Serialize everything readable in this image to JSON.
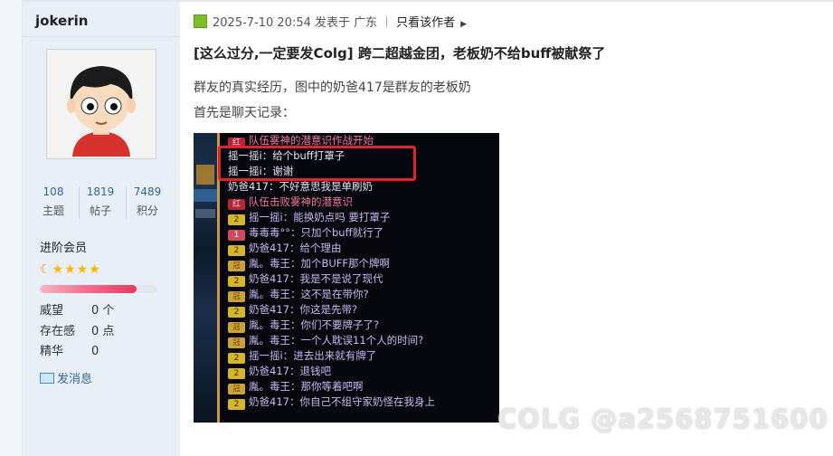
{
  "sidebar": {
    "username": "jokerin",
    "stats": [
      {
        "value": "108",
        "label": "主题"
      },
      {
        "value": "1819",
        "label": "帖子"
      },
      {
        "value": "7489",
        "label": "积分"
      }
    ],
    "rank": "进阶会员",
    "level_progress": 0.82,
    "info": [
      {
        "key": "威望",
        "value": "0 个"
      },
      {
        "key": "存在感",
        "value": "0 点"
      },
      {
        "key": "精华",
        "value": "0"
      }
    ],
    "message_label": "发消息"
  },
  "post": {
    "meta_time": "2025-7-10 20:54",
    "meta_location": "发表于 广东",
    "author_only": "只看该作者",
    "title": "[这么过分,一定要发Colg] 跨二超越金团，老板奶不给buff被献祭了",
    "para1": "群友的真实经历，图中的奶爸417是群友的老板奶",
    "para2": "首先是聊天记录："
  },
  "chat": [
    {
      "badge": "红",
      "badge_type": "red",
      "text": "队伍雾神的潜意识作战开始",
      "color": "pink"
    },
    {
      "badge": "",
      "badge_type": "",
      "text": "摇一摇i：给个buff打罩子",
      "color": "light"
    },
    {
      "badge": "",
      "badge_type": "",
      "text": "摇一摇i：谢谢",
      "color": "light"
    },
    {
      "badge": "",
      "badge_type": "",
      "text": "奶爸417：不好意思我是单刷奶",
      "color": "light"
    },
    {
      "badge": "红",
      "badge_type": "red",
      "text": "队伍击败雾神的潜意识",
      "color": "pink"
    },
    {
      "badge": "2",
      "badge_type": "two",
      "text": "摇一摇i：能换奶点吗 要打罩子",
      "color": "purp"
    },
    {
      "badge": "1",
      "badge_type": "one",
      "text": "毒毒毒°°：只加个buff就行了",
      "color": "purp"
    },
    {
      "badge": "2",
      "badge_type": "two",
      "text": "奶爸417：给个理由",
      "color": "purp"
    },
    {
      "badge": "冠",
      "badge_type": "crown",
      "text": "胤。毒王：加个BUFF那个牌啊",
      "color": "purp"
    },
    {
      "badge": "2",
      "badge_type": "two",
      "text": "奶爸417：我是不是说了现代",
      "color": "purp"
    },
    {
      "badge": "冠",
      "badge_type": "crown",
      "text": "胤。毒王：这不是在带你?",
      "color": "purp"
    },
    {
      "badge": "2",
      "badge_type": "two",
      "text": "奶爸417：你这是先带?",
      "color": "purp"
    },
    {
      "badge": "冠",
      "badge_type": "crown",
      "text": "胤。毒王：你们不要牌子了?",
      "color": "purp"
    },
    {
      "badge": "冠",
      "badge_type": "crown",
      "text": "胤。毒王：一个人耽误11个人的时间?",
      "color": "purp"
    },
    {
      "badge": "2",
      "badge_type": "two",
      "text": "摇一摇i：进去出来就有牌了",
      "color": "purp"
    },
    {
      "badge": "2",
      "badge_type": "two",
      "text": "奶爸417：退钱吧",
      "color": "purp"
    },
    {
      "badge": "冠",
      "badge_type": "crown",
      "text": "胤。毒王：那你等着吧啊",
      "color": "purp"
    },
    {
      "badge": "2",
      "badge_type": "two",
      "text": "奶爸417：你自己不组守家奶怪在我身上",
      "color": "purp"
    }
  ],
  "watermark": "COLG @a2568751600",
  "colors": {
    "sidebar_bg": "#e8eff7",
    "link": "#336699",
    "highlight_box": "#e0242e",
    "progress": "#e53a62"
  }
}
